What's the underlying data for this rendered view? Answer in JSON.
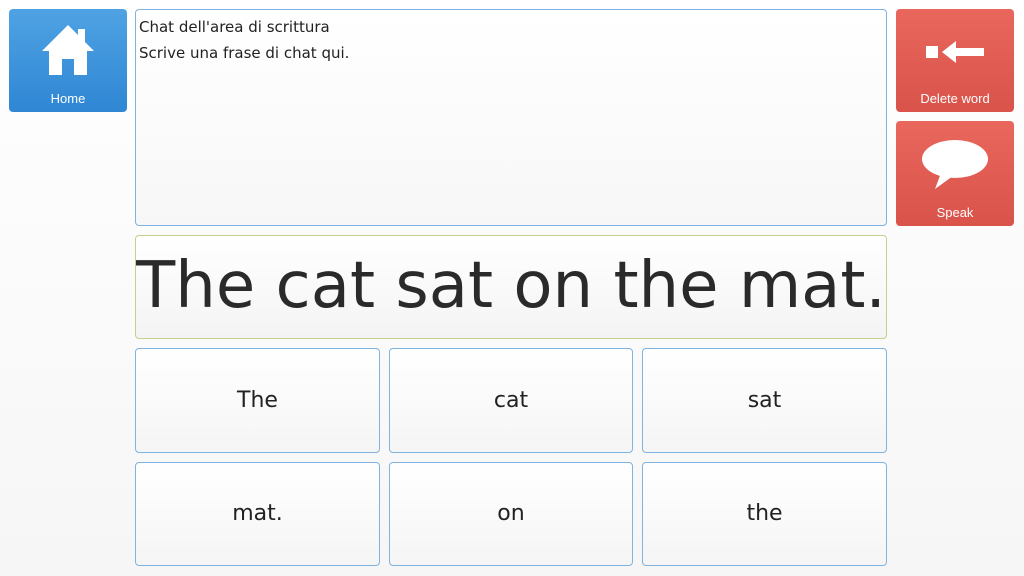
{
  "home_button": {
    "label": "Home",
    "icon": "house-icon",
    "color": "#3a8fd9"
  },
  "delete_button": {
    "label": "Delete word",
    "icon": "backspace-arrow-icon",
    "color": "#e05a50"
  },
  "speak_button": {
    "label": "Speak",
    "icon": "speech-bubble-icon",
    "color": "#e05a50"
  },
  "chat_area": {
    "lines": [
      "Chat dell'area di scrittura",
      "Scrive una frase di chat qui."
    ]
  },
  "sentence": {
    "text": "The cat sat on the mat."
  },
  "words": [
    "The",
    "cat",
    "sat",
    "mat.",
    "on",
    "the"
  ]
}
